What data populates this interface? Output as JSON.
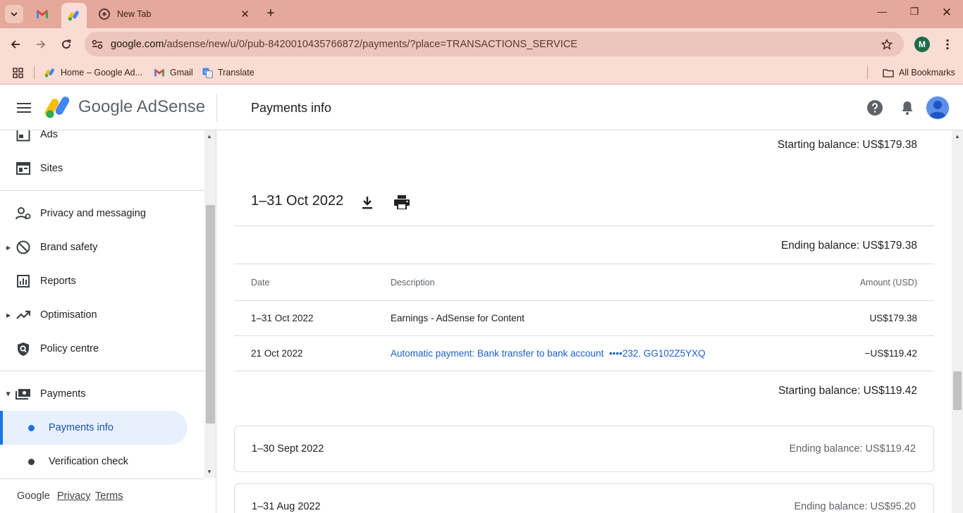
{
  "browser": {
    "tabs": [
      {
        "title": "",
        "favicon": "gmail-icon"
      },
      {
        "title": "",
        "favicon": "adsense-icon"
      },
      {
        "title": "New Tab",
        "favicon": "chrome-icon"
      }
    ],
    "url_host": "google.com",
    "url_path": "/adsense/new/u/0/pub-8420010435766872/payments/?place=TRANSACTIONS_SERVICE",
    "profile_initial": "M",
    "bookmarks": [
      {
        "label": "Home – Google Ad...",
        "icon": "adsense-icon"
      },
      {
        "label": "Gmail",
        "icon": "gmail-icon"
      },
      {
        "label": "Translate",
        "icon": "translate-icon"
      }
    ],
    "all_bookmarks_label": "All Bookmarks"
  },
  "app": {
    "name": "Google AdSense",
    "page_title": "Payments info"
  },
  "sidebar": {
    "items": [
      {
        "label": "Ads",
        "icon": "ads-icon"
      },
      {
        "label": "Sites",
        "icon": "sites-icon"
      },
      {
        "label": "Privacy and messaging",
        "icon": "privacy-icon"
      },
      {
        "label": "Brand safety",
        "icon": "block-icon"
      },
      {
        "label": "Reports",
        "icon": "reports-icon"
      },
      {
        "label": "Optimisation",
        "icon": "trending-icon"
      },
      {
        "label": "Policy centre",
        "icon": "policy-icon"
      },
      {
        "label": "Payments",
        "icon": "payments-icon"
      }
    ],
    "sub_items": [
      {
        "label": "Payments info",
        "active": true
      },
      {
        "label": "Verification check",
        "active": false
      }
    ],
    "footer": {
      "brand": "Google",
      "privacy": "Privacy",
      "terms": "Terms"
    }
  },
  "main": {
    "top_starting_balance": "Starting balance: US$179.38",
    "period": {
      "title": "1–31 Oct 2022",
      "ending_balance": "Ending balance: US$179.38",
      "columns": {
        "date": "Date",
        "description": "Description",
        "amount": "Amount (USD)"
      },
      "rows": [
        {
          "date": "1–31 Oct 2022",
          "description": "Earnings - AdSense for Content",
          "amount": "US$179.38"
        },
        {
          "date": "21 Oct 2022",
          "description": "Automatic payment: Bank transfer to bank account  ••••232. GG102Z5YXQ",
          "amount": "−US$119.42"
        }
      ],
      "starting_balance": "Starting balance: US$119.42"
    },
    "collapsed_periods": [
      {
        "title": "1–30 Sept 2022",
        "ending_balance": "Ending balance: US$119.42"
      },
      {
        "title": "1–31 Aug 2022",
        "ending_balance": "Ending balance: US$95.20"
      }
    ]
  }
}
